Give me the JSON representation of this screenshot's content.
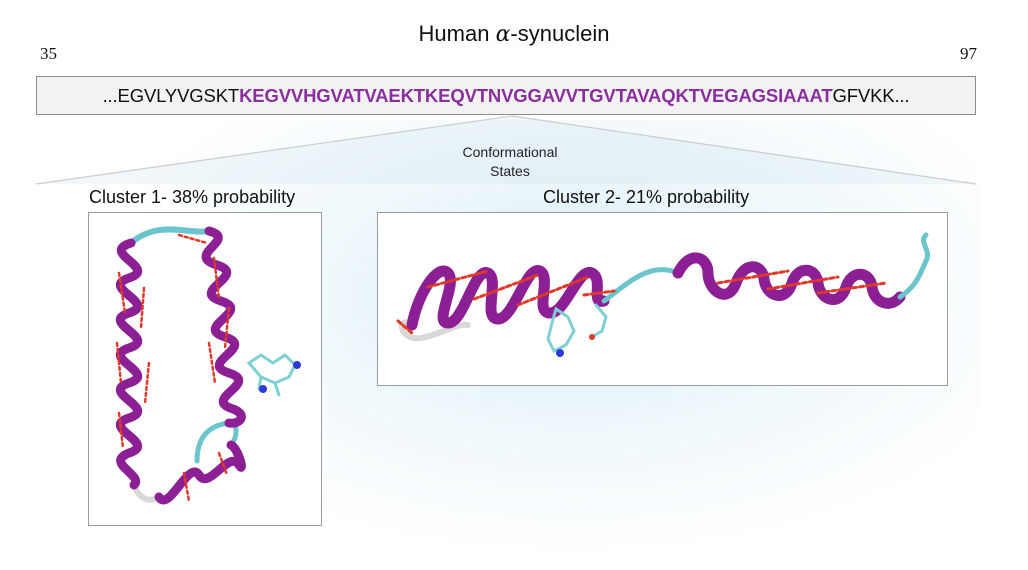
{
  "title": {
    "prefix": "Human ",
    "greek": "α",
    "suffix": "-synuclein"
  },
  "sequence": {
    "start_number": "35",
    "end_number": "97",
    "before": "...EGVLYVGSKT",
    "highlighted": "KEGVVHGVATVAEKTKEQVTNVGGAVVTGVTAVAQKTVEGAGSIAAAT",
    "after": "GFVKK...",
    "highlight_color": "#8b2f9f"
  },
  "states_label": {
    "line1": "Conformational",
    "line2": "States"
  },
  "clusters": [
    {
      "label": "Cluster 1- 38% probability"
    },
    {
      "label": "Cluster 2- 21% probability"
    }
  ],
  "colors": {
    "helix": "#8b1f93",
    "helix_dark": "#5f0f67",
    "coil": "#6cc4cc",
    "turn": "#d8d8d8",
    "hbond": "#e0392a",
    "nitrogen": "#2a3ad6",
    "carbon": "#7fd0d6"
  }
}
